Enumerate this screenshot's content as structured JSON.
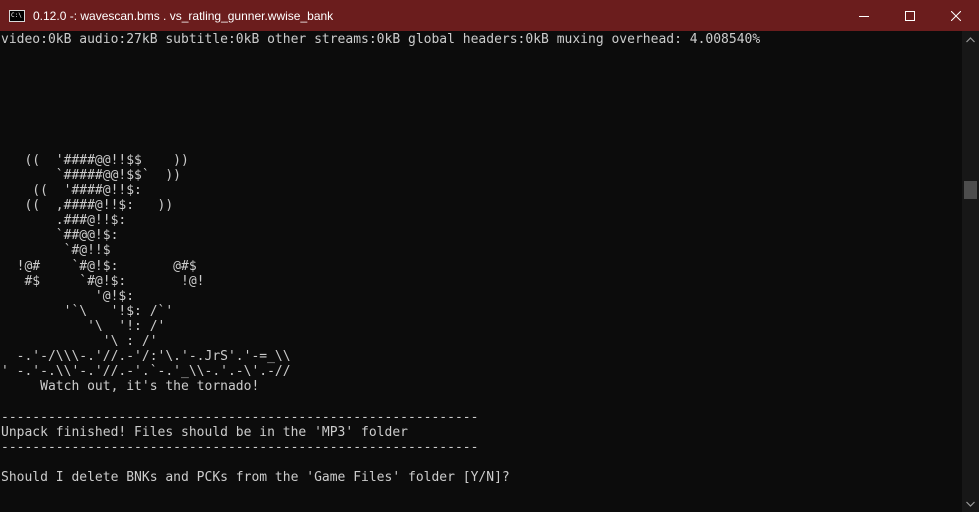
{
  "window": {
    "title": "0.12.0 -: wavescan.bms . vs_ratling_gunner.wwise_bank",
    "app_icon_text": "C:\\",
    "minimize_icon": "minimize-icon",
    "maximize_icon": "maximize-icon",
    "close_icon": "close-icon"
  },
  "console": {
    "lines": [
      "video:0kB audio:27kB subtitle:0kB other streams:0kB global headers:0kB muxing overhead: 4.008540%",
      "",
      "",
      "",
      "",
      "",
      "",
      "",
      "   ((  '####@@!!$$    ))",
      "       `#####@@!$$`  ))",
      "    ((  '####@!!$:",
      "   ((  ,####@!!$:   ))",
      "       .###@!!$:",
      "       `##@@!$:",
      "        `#@!!$",
      "  !@#    `#@!$:       @#$",
      "   #$     `#@!$:       !@!",
      "            '@!$:",
      "        '`\\   '!$: /`'",
      "           '\\  '!: /'",
      "             '\\ : /'",
      "  -.'-/\\\\\\-.'//.-'/:'\\.'-.JrS'.'-=_\\\\",
      "' -.'-.\\\\'-.'//.-'.`-.'_\\\\-.'.-\\'.-//",
      "     Watch out, it's the tornado!",
      "",
      "-------------------------------------------------------------",
      "Unpack finished! Files should be in the 'MP3' folder",
      "-------------------------------------------------------------",
      "",
      "Should I delete BNKs and PCKs from the 'Game Files' folder [Y/N]?"
    ]
  },
  "scrollbar": {
    "up_icon": "scroll-up-arrow-icon",
    "down_icon": "scroll-down-arrow-icon",
    "position_fraction": 0.31
  },
  "colors": {
    "titlebar": "#6b1d1d",
    "console_bg": "#0c0c0c",
    "console_text": "#cccccc",
    "scrollbar_track": "#171717",
    "scrollbar_thumb": "#4d4d4d"
  }
}
